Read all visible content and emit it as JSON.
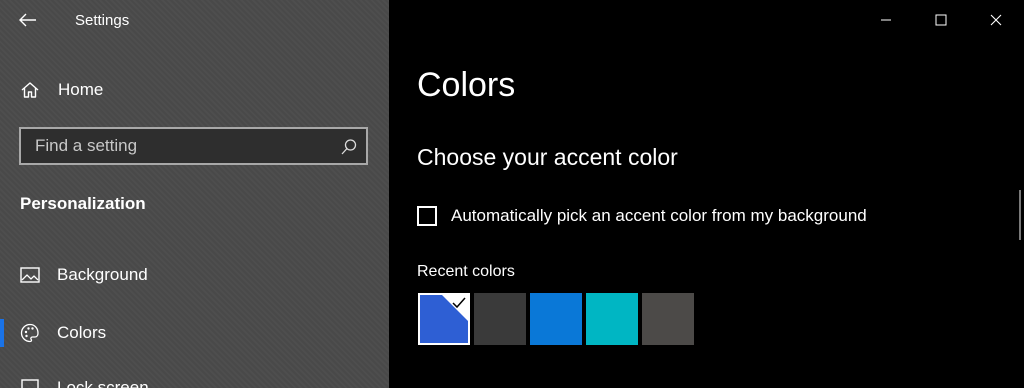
{
  "app": {
    "title": "Settings"
  },
  "sidebar": {
    "home_label": "Home",
    "search_placeholder": "Find a setting",
    "section_heading": "Personalization",
    "items": [
      {
        "label": "Background",
        "icon": "image-icon"
      },
      {
        "label": "Colors",
        "icon": "palette-icon",
        "selected": true
      },
      {
        "label": "Lock screen",
        "icon": "lock-screen-icon"
      }
    ],
    "accent_color": "#1a73e8"
  },
  "main": {
    "title": "Colors",
    "accent_heading": "Choose your accent color",
    "auto_pick_label": "Automatically pick an accent color from my background",
    "auto_pick_checked": false,
    "recent_colors_label": "Recent colors",
    "recent_colors": [
      "#2e5fd4",
      "#3a3a3a",
      "#0a78d7",
      "#00b6c3",
      "#4c4a48"
    ],
    "selected_recent_index": 0
  },
  "window_controls": [
    "minimize",
    "maximize",
    "close"
  ]
}
